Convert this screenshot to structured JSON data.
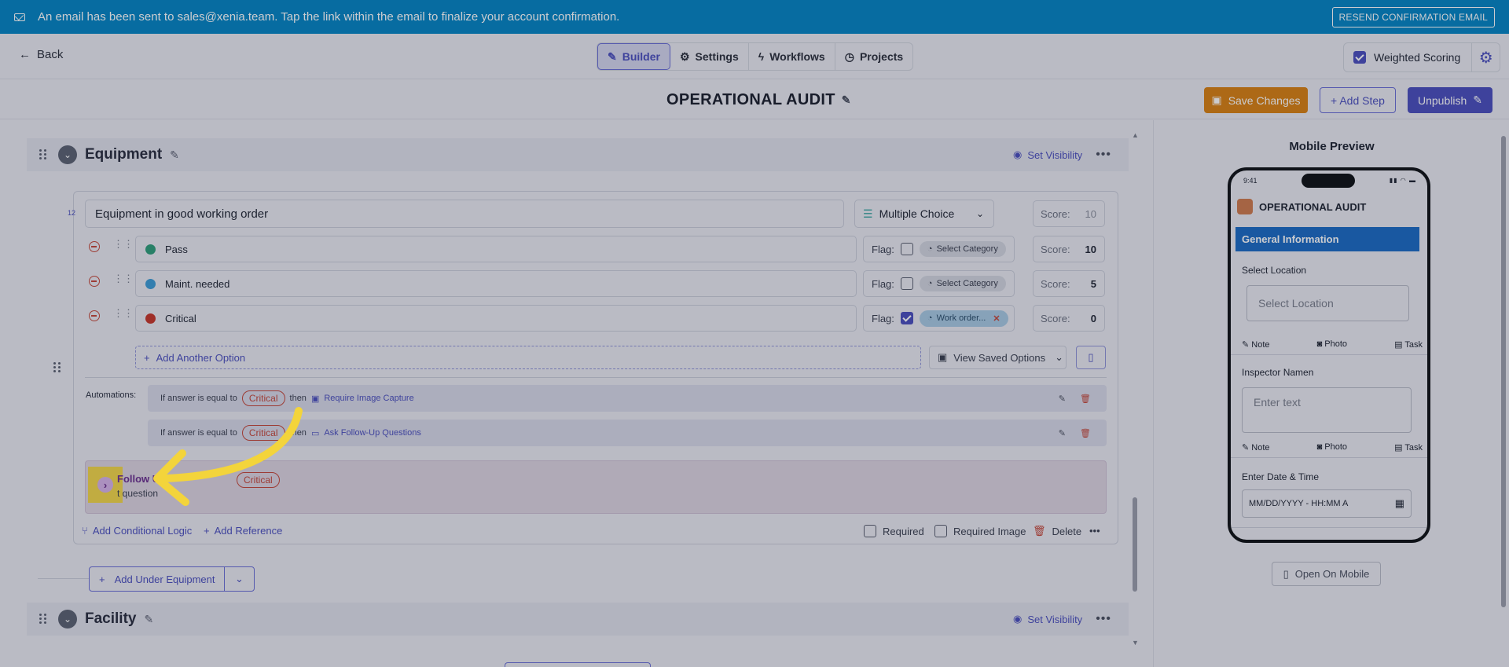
{
  "banner": {
    "message": "An email has been sent to sales@xenia.team. Tap the link within the email to finalize your account confirmation.",
    "resend_label": "RESEND CONFIRMATION EMAIL"
  },
  "nav": {
    "back_label": "Back",
    "tabs": [
      {
        "label": "Builder",
        "active": true,
        "icon": "edit-icon"
      },
      {
        "label": "Settings",
        "active": false,
        "icon": "gear-icon"
      },
      {
        "label": "Workflows",
        "active": false,
        "icon": "lightning-icon"
      },
      {
        "label": "Projects",
        "active": false,
        "icon": "clock-icon"
      }
    ],
    "weighted_scoring_label": "Weighted Scoring",
    "weighted_scoring_checked": true
  },
  "title_bar": {
    "title": "OPERATIONAL AUDIT",
    "save_label": "Save Changes",
    "add_step_label": "+ Add Step",
    "unpublish_label": "Unpublish"
  },
  "sections": [
    {
      "name": "Equipment",
      "set_visibility_label": "Set Visibility"
    },
    {
      "name": "Facility",
      "set_visibility_label": "Set Visibility"
    }
  ],
  "question": {
    "number": "12",
    "title": "Equipment in good working order",
    "type": "Multiple Choice",
    "score_label": "Score:",
    "score_value": "10",
    "options": [
      {
        "label": "Pass",
        "color": "#2f9e7a",
        "flag_label": "Flag:",
        "flagged": false,
        "category": "Select Category",
        "score": "10"
      },
      {
        "label": "Maint. needed",
        "color": "#3d9bd6",
        "flag_label": "Flag:",
        "flagged": false,
        "category": "Select Category",
        "score": "5"
      },
      {
        "label": "Critical",
        "color": "#c7362b",
        "flag_label": "Flag:",
        "flagged": true,
        "category": "Work order...",
        "score": "0"
      }
    ],
    "add_option_label": "Add Another Option",
    "view_saved_label": "View Saved Options",
    "automations_label": "Automations:",
    "automations": [
      {
        "prefix": "If answer is equal to",
        "value": "Critical",
        "then": "then",
        "action": "Require Image Capture"
      },
      {
        "prefix": "If answer is equal to",
        "value": "Critical",
        "then": "then",
        "action": "Ask Follow-Up Questions"
      }
    ],
    "followup": {
      "title": "Follow U",
      "subtitle": "t question",
      "condition": "Critical"
    },
    "add_logic_label": "Add Conditional Logic",
    "add_reference_label": "Add Reference",
    "required_label": "Required",
    "required_image_label": "Required Image",
    "delete_label": "Delete"
  },
  "add_under_label": "Add Under Equipment",
  "preview": {
    "title": "Mobile Preview",
    "time": "9:41",
    "app_title": "OPERATIONAL AUDIT",
    "section": "General Information",
    "select_location_label": "Select Location",
    "select_location_placeholder": "Select Location",
    "tools": [
      "Note",
      "Photo",
      "Task"
    ],
    "inspector_label": "Inspector Namen",
    "inspector_placeholder": "Enter text",
    "date_label": "Enter Date & Time",
    "date_placeholder": "MM/DD/YYYY - HH:MM A",
    "open_mobile_label": "Open On Mobile"
  },
  "colors": {
    "banner": "#0585c4",
    "accent": "#4b4fbe",
    "save": "#d98013",
    "danger": "#c4473a",
    "highlight": "#f2d64a"
  }
}
